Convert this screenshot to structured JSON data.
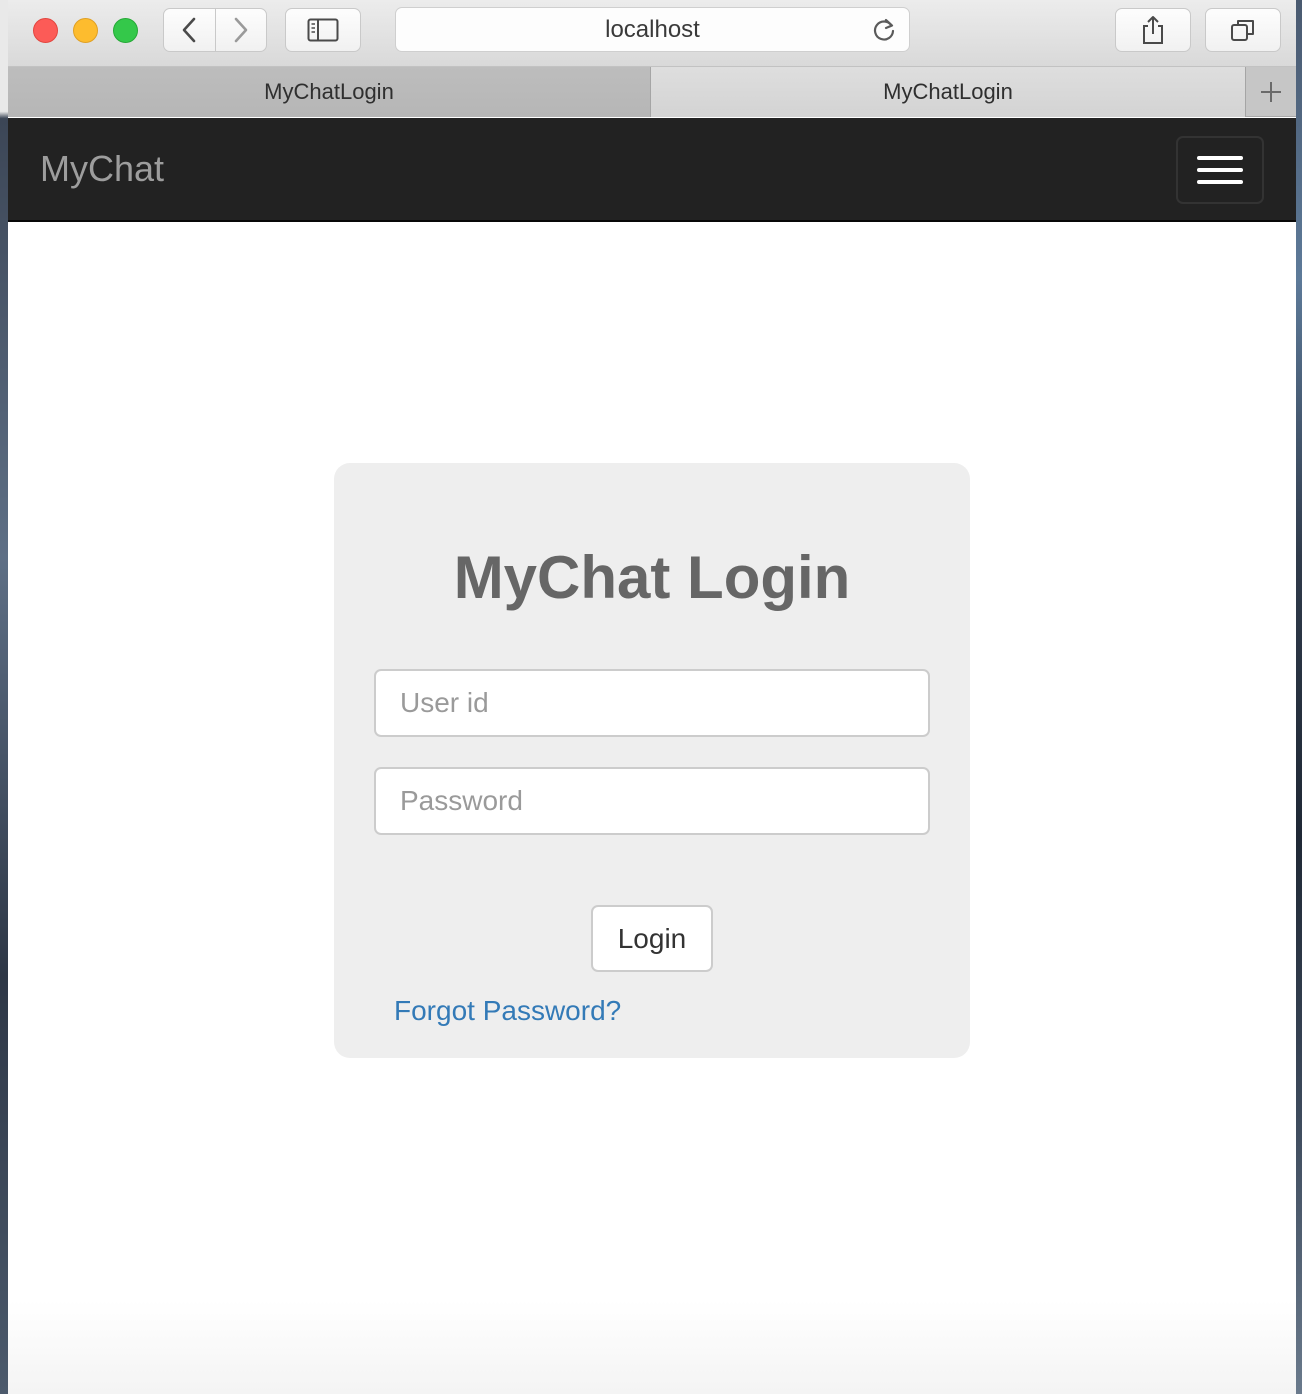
{
  "browser": {
    "address": "localhost",
    "tabs": [
      {
        "label": "MyChatLogin",
        "active": false
      },
      {
        "label": "MyChatLogin",
        "active": true
      }
    ]
  },
  "navbar": {
    "brand": "MyChat",
    "bg_color": "#222222"
  },
  "login": {
    "title": "MyChat Login",
    "user_placeholder": "User id",
    "password_placeholder": "Password",
    "submit_label": "Login",
    "forgot_label": "Forgot Password?",
    "link_color": "#337ab7"
  }
}
